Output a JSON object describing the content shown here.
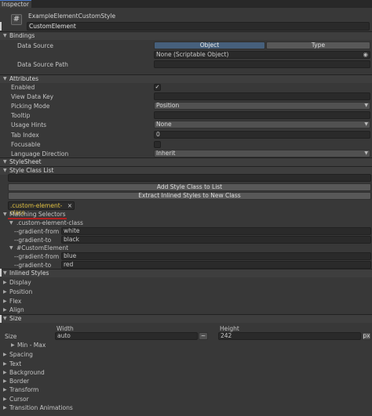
{
  "window": {
    "tab": "Inspector"
  },
  "header": {
    "component_icon": "hash-icon",
    "title": "ExampleElementCustomStyle",
    "name_value": "CustomElement"
  },
  "bindings": {
    "section_label": "Bindings",
    "data_source_label": "Data Source",
    "segment_object": "Object",
    "segment_type": "Type",
    "data_source_value": "None (Scriptable Object)",
    "data_source_path_label": "Data Source Path"
  },
  "attributes": {
    "section_label": "Attributes",
    "enabled_label": "Enabled",
    "enabled_checked": "✓",
    "view_data_key_label": "View Data Key",
    "picking_mode_label": "Picking Mode",
    "picking_mode_value": "Position",
    "tooltip_label": "Tooltip",
    "usage_hints_label": "Usage Hints",
    "usage_hints_value": "None",
    "tab_index_label": "Tab Index",
    "tab_index_value": "0",
    "focusable_label": "Focusable",
    "language_direction_label": "Language Direction",
    "language_direction_value": "Inherit"
  },
  "stylesheet": {
    "section_label": "StyleSheet",
    "style_class_list_label": "Style Class List",
    "add_class_button": "Add Style Class to List",
    "extract_button": "Extract Inlined Styles to New Class",
    "class_pill": ".custom-element-class",
    "class_pill_remove": "×",
    "matching_selectors_label": "Matching Selectors",
    "selectors": [
      {
        "name": ".custom-element-class",
        "props": [
          {
            "name": "--gradient-from",
            "value": "white"
          },
          {
            "name": "--gradient-to",
            "value": "black"
          }
        ]
      },
      {
        "name": "#CustomElement",
        "props": [
          {
            "name": "--gradient-from",
            "value": "blue"
          },
          {
            "name": "--gradient-to",
            "value": "red"
          }
        ]
      }
    ]
  },
  "inlined": {
    "section_label": "Inlined Styles",
    "groups_top": [
      "Display",
      "Position",
      "Flex",
      "Align"
    ],
    "size_label": "Size",
    "width_header": "Width",
    "height_header": "Height",
    "size_row_label": "Size",
    "width_value": "auto",
    "width_unit": "~",
    "height_value": "242",
    "height_unit": "px",
    "min_max_label": "Min - Max",
    "groups_bottom": [
      "Spacing",
      "Text",
      "Background",
      "Border",
      "Transform",
      "Cursor",
      "Transition Animations"
    ]
  },
  "colors": {
    "accent": "#46607c",
    "selector_text": "#e0c040",
    "underline": "#b02020"
  }
}
